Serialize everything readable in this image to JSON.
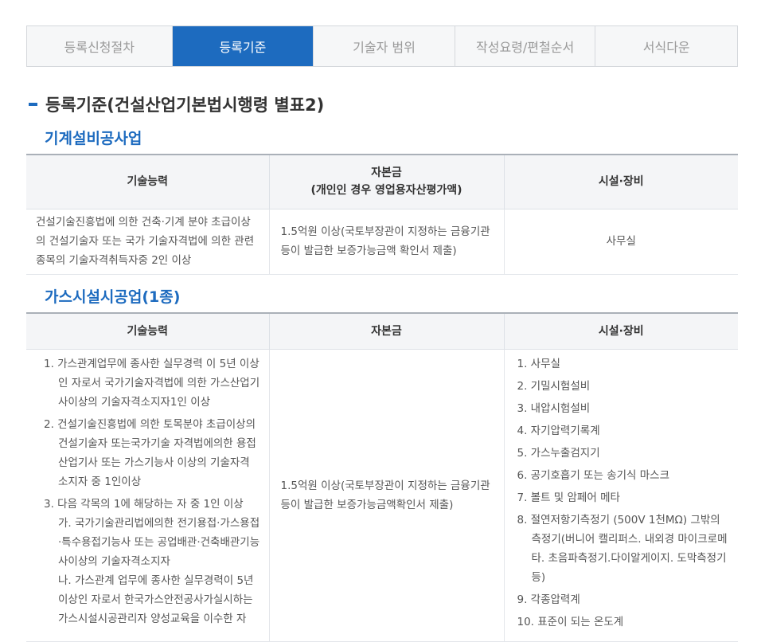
{
  "tabs": [
    "등록신청절차",
    "등록기준",
    "기술자 범위",
    "작성요령/편철순서",
    "서식다운"
  ],
  "active_tab": 1,
  "page_title": "등록기준(건설산업기본법시행령 별표2)",
  "section1": {
    "title": "기계설비공사업",
    "headers": [
      "기술능력",
      "자본금",
      "(개인인 경우 영업용자산평가액)",
      "시설·장비"
    ],
    "row": [
      "건설기술진흥법에 의한 건축·기계 분야 초급이상의 건설기술자 또는 국가 기술자격법에 의한 관련종목의 기술자격취득자중 2인 이상",
      "1.5억원 이상(국토부장관이 지정하는 금융기관 등이 발급한 보증가능금액 확인서 제출)",
      "사무실"
    ]
  },
  "section2": {
    "title": "가스시설시공업(1종)",
    "headers": [
      "기술능력",
      "자본금",
      "시설·장비"
    ],
    "tech": [
      "1. 가스관계업무에 종사한 실무경력 이 5년 이상인 자로서 국가기술자격법에 의한 가스산업기사이상의 기술자격소지자1인 이상",
      "2. 건설기술진흥법에 의한 토목분야 초급이상의 건설기술자 또는국가기술 자격법에의한 용접산업기사 또는 가스기능사 이상의 기술자격 소지자 중 1인이상",
      "3. 다음 각목의 1에 해당하는 자 중 1인 이상\n가. 국가기술관리법에의한 전기용접·가스용접·특수용접기능사 또는 공업배관·건축배관기능사이상의 기술자격소지자\n나. 가스관계 업무에 종사한 실무경력이 5년이상인 자로서 한국가스안전공사가실시하는 가스시설시공관리자 양성교육을 이수한 자"
    ],
    "capital": "1.5억원 이상(국토부장관이 지정하는 금융기관 등이 발급한 보증가능금액확인서 제출)",
    "equipment": [
      "1. 사무실",
      "2. 기밀시험설비",
      "3. 내압시험설비",
      "4. 자기압력기록계",
      "5. 가스누출검지기",
      "6. 공기호흡기 또는 송기식 마스크",
      "7. 볼트 및 암페어 메타",
      "8. 절연저항기측정기 (500V 1천MΩ) 그밖의 측정기(버니어 캘리퍼스. 내외경 마이크로메타. 초음파측정기.다이알게이지. 도막측정기등)",
      "9. 각종압력계",
      "10. 표준이 되는 온도계"
    ]
  }
}
